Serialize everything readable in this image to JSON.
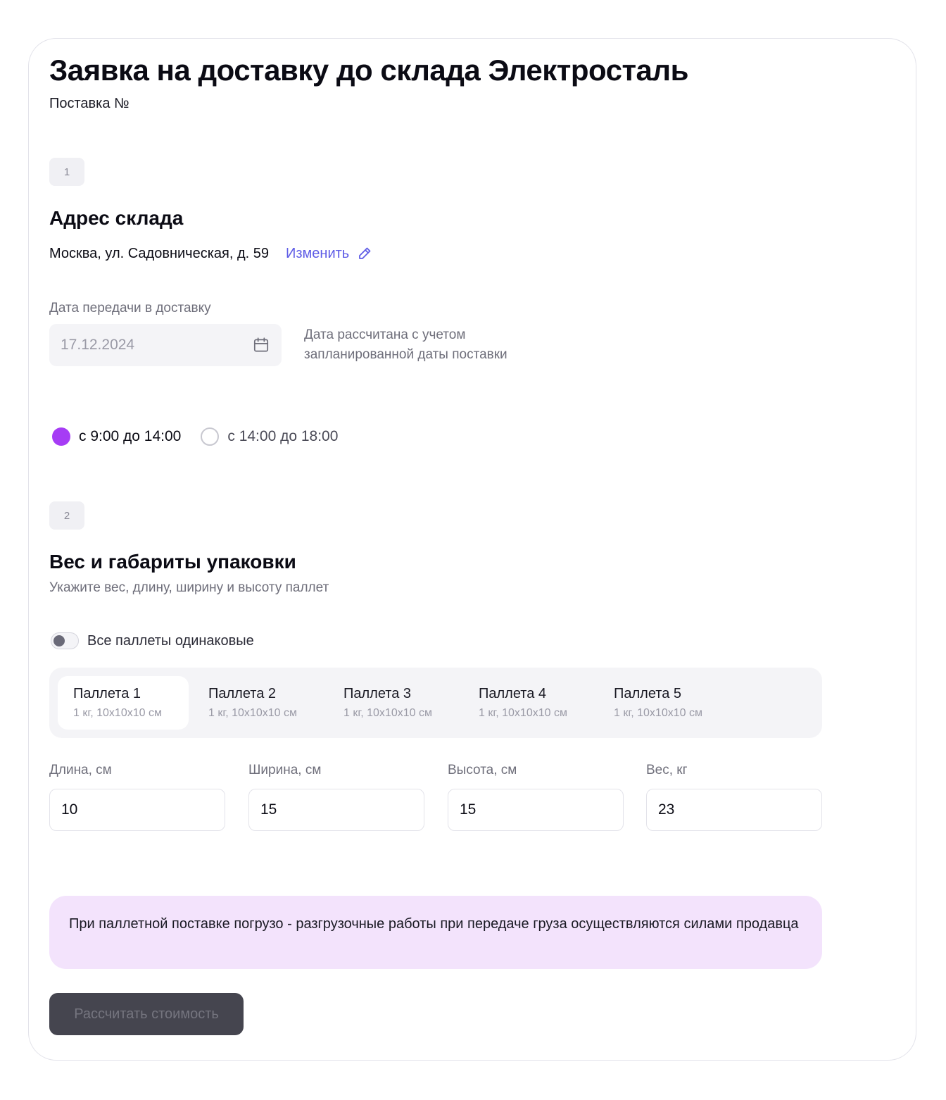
{
  "header": {
    "title": "Заявка на доставку до склада Электросталь",
    "subtitle": "Поставка №"
  },
  "step1": {
    "badge": "1",
    "title": "Адрес склада",
    "address": "Москва, ул. Садовническая, д. 59",
    "change_label": "Изменить",
    "date_label": "Дата передачи в доставку",
    "date_value": "17.12.2024",
    "date_note": "Дата рассчитана с учетом запланированной даты поставки",
    "time_slots": [
      {
        "label": "с 9:00 до 14:00",
        "selected": true
      },
      {
        "label": "с 14:00 до 18:00",
        "selected": false
      }
    ]
  },
  "step2": {
    "badge": "2",
    "title": "Вес и габариты упаковки",
    "description": "Укажите вес, длину, ширину и высоту паллет",
    "toggle_label": "Все паллеты одинаковые",
    "toggle_on": false,
    "pallets": [
      {
        "title": "Паллета 1",
        "summary": "1 кг, 10x10x10 см",
        "active": true
      },
      {
        "title": "Паллета 2",
        "summary": "1 кг, 10x10x10 см",
        "active": false
      },
      {
        "title": "Паллета 3",
        "summary": "1 кг, 10x10x10 см",
        "active": false
      },
      {
        "title": "Паллета 4",
        "summary": "1 кг, 10x10x10 см",
        "active": false
      },
      {
        "title": "Паллета 5",
        "summary": "1 кг, 10x10x10 см",
        "active": false
      }
    ],
    "dimensions": {
      "length": {
        "label": "Длина, см",
        "value": "10"
      },
      "width": {
        "label": "Ширина, см",
        "value": "15"
      },
      "height": {
        "label": "Высота, см",
        "value": "15"
      },
      "weight": {
        "label": "Вес, кг",
        "value": "23"
      }
    }
  },
  "notice": {
    "text": "При паллетной поставке погрузо - разгрузочные работы при передаче груза осуществляются силами продавца"
  },
  "actions": {
    "calculate_label": "Рассчитать стоимость",
    "calculate_disabled": true
  },
  "colors": {
    "accent_radio": "#a63cf5",
    "link": "#5e5ce6",
    "notice_bg": "#f3e3fc",
    "button_bg": "#45454f"
  },
  "icons": {
    "change": "pencil-icon",
    "date": "calendar-icon"
  }
}
